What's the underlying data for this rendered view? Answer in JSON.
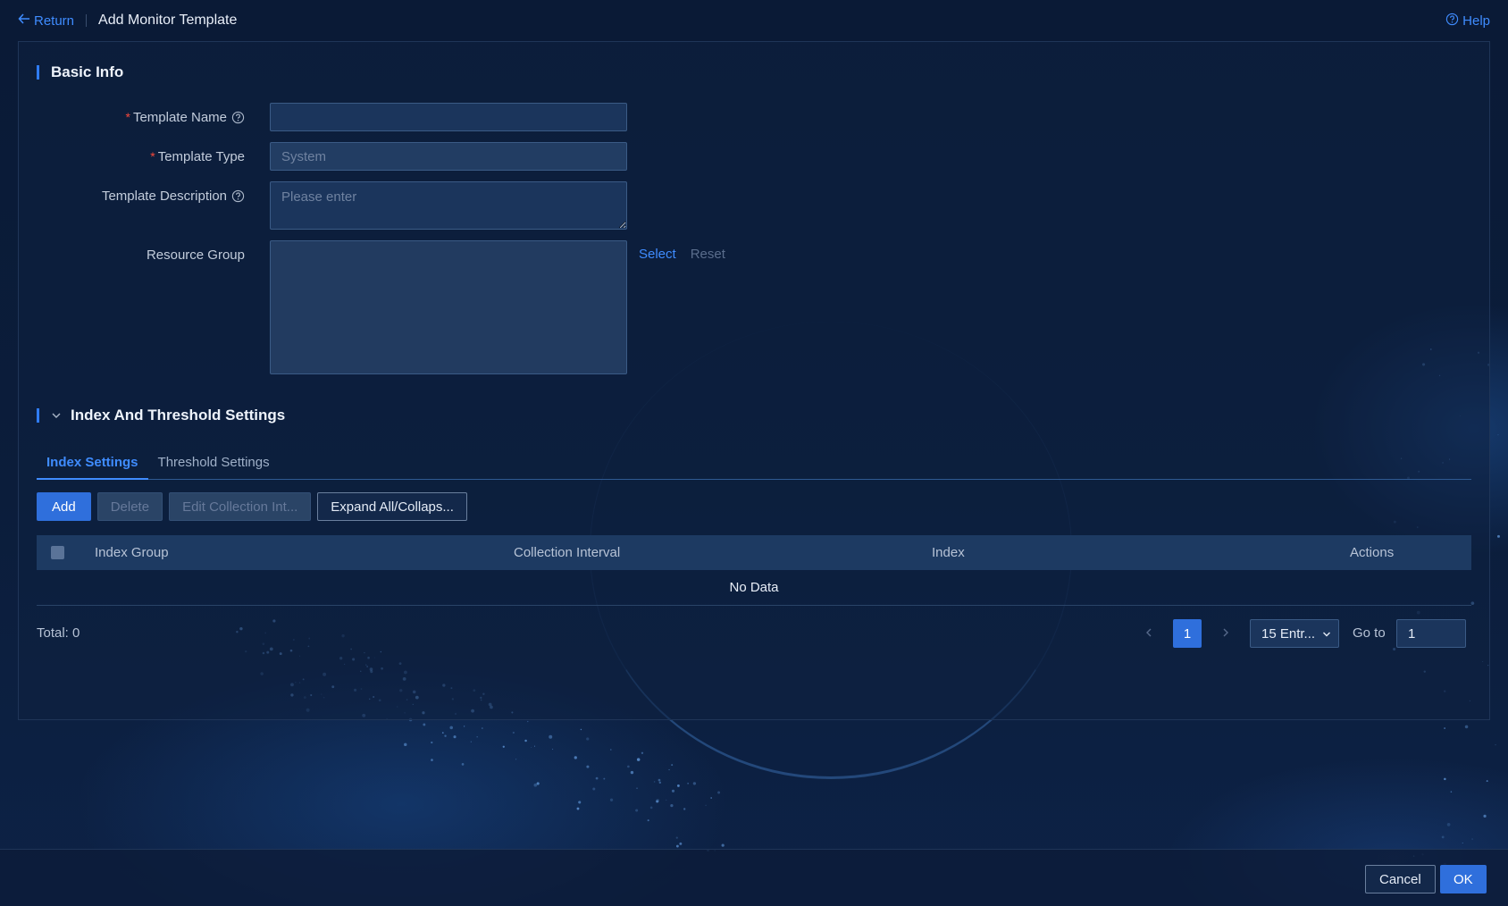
{
  "header": {
    "return_label": "Return",
    "title": "Add Monitor Template",
    "help_label": "Help"
  },
  "basic_info": {
    "section_title": "Basic Info",
    "template_name": {
      "label": "Template Name",
      "required": true,
      "value": ""
    },
    "template_type": {
      "label": "Template Type",
      "required": true,
      "value": "System"
    },
    "template_description": {
      "label": "Template Description",
      "placeholder": "Please enter",
      "value": ""
    },
    "resource_group": {
      "label": "Resource Group",
      "select_label": "Select",
      "reset_label": "Reset"
    }
  },
  "index_threshold": {
    "section_title": "Index And Threshold Settings",
    "tabs": [
      {
        "label": "Index Settings",
        "active": true
      },
      {
        "label": "Threshold Settings",
        "active": false
      }
    ],
    "toolbar": {
      "add_label": "Add",
      "delete_label": "Delete",
      "edit_interval_label": "Edit Collection Int...",
      "expand_collapse_label": "Expand All/Collaps..."
    },
    "table": {
      "columns": [
        "Index Group",
        "Collection Interval",
        "Index",
        "Actions"
      ],
      "empty_text": "No Data"
    },
    "pagination": {
      "total_label": "Total: 0",
      "current_page": "1",
      "page_size_label": "15 Entr...",
      "goto_label": "Go to",
      "goto_value": "1"
    }
  },
  "footer": {
    "cancel_label": "Cancel",
    "ok_label": "OK"
  },
  "colors": {
    "background": "#0b1d3b",
    "accent": "#2f6fdc",
    "link": "#3f8cff",
    "required": "#f5483b"
  },
  "icons": [
    "arrow-left-icon",
    "question-circle-icon",
    "chevron-down-icon",
    "chevron-left-icon",
    "chevron-right-icon"
  ]
}
